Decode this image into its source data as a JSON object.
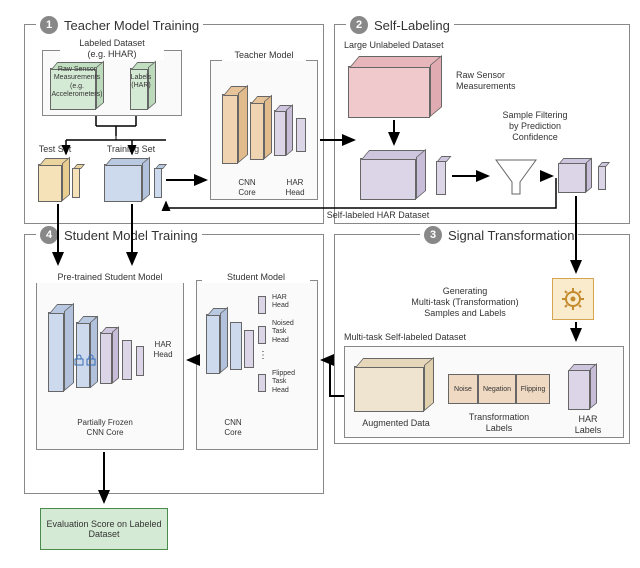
{
  "sections": {
    "s1": {
      "num": "1",
      "title": "Teacher Model Training"
    },
    "s2": {
      "num": "2",
      "title": "Self-Labeling"
    },
    "s3": {
      "num": "3",
      "title": "Signal Transformation"
    },
    "s4": {
      "num": "4",
      "title": "Student Model Training"
    }
  },
  "labels": {
    "labeled_dataset": "Labeled Dataset\n(e.g. HHAR)",
    "raw_sensor": "Raw Sensor\nMeasurements\n(e.g.\nAccelerometers)",
    "labels_har": "Labels\n(HAR)",
    "test_set": "Test Set",
    "training_set": "Training Set",
    "teacher_model": "Teacher Model",
    "cnn_core": "CNN\nCore",
    "har_head": "HAR\nHead",
    "large_unlabeled": "Large Unlabeled Dataset",
    "raw_sensor2": "Raw Sensor\nMeasurements",
    "sample_filtering": "Sample Filtering\nby Prediction\nConfidence",
    "self_labeled": "Self-labeled HAR Dataset",
    "generating": "Generating\nMulti-task (Transformation)\nSamples and Labels",
    "multitask_ds": "Multi-task Self-labeled Dataset",
    "augmented": "Augmented Data",
    "trans_labels": "Transformation\nLabels",
    "har_labels": "HAR\nLabels",
    "noise": "Noise",
    "negation": "Negation",
    "flipping": "Flipping",
    "student_model": "Student Model",
    "pretrained": "Pre-trained Student Model",
    "har_head2": "HAR\nHead",
    "noised_head": "Noised\nTask\nHead",
    "flipped_head": "Flipped\nTask\nHead",
    "cnn_core2": "CNN\nCore",
    "har_head3": "HAR\nHead",
    "frozen": "Partially Frozen\nCNN Core",
    "eval": "Evaluation Score on\nLabeled Dataset"
  }
}
